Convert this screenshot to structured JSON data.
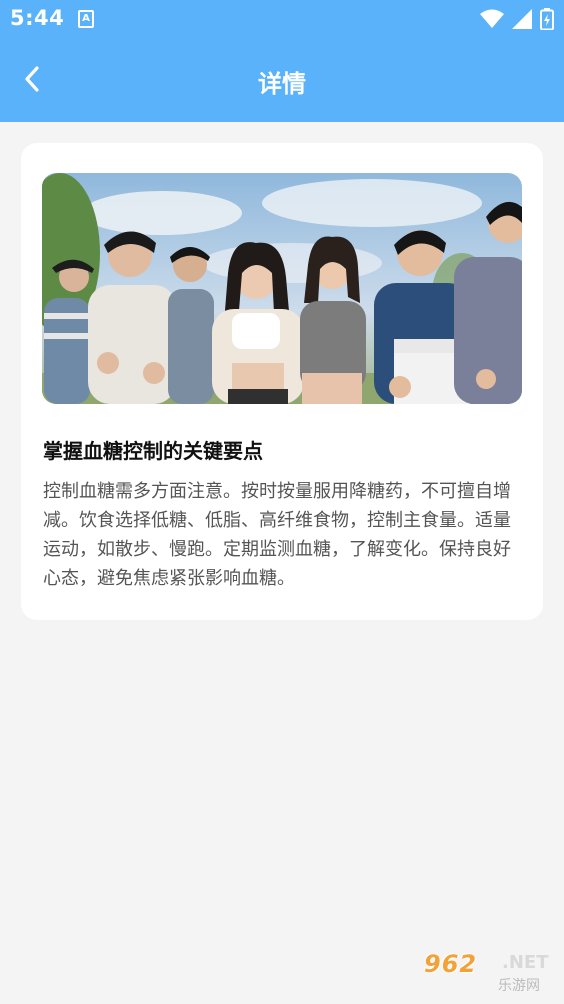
{
  "status_bar": {
    "time": "5:44",
    "notification_badge": "A",
    "icons": [
      "wifi-icon",
      "signal-icon",
      "battery-icon"
    ]
  },
  "header": {
    "title": "详情",
    "back_icon": "chevron-left-icon"
  },
  "article": {
    "image_description": "group of young people running outdoors",
    "title": "掌握血糖控制的关键要点",
    "body": "控制血糖需多方面注意。按时按量服用降糖药，不可擅自增减。饮食选择低糖、低脂、高纤维食物，控制主食量。适量运动，如散步、慢跑。定期监测血糖，了解变化。保持良好心态，避免焦虑紧张影响血糖。"
  },
  "watermark": {
    "brand": "962",
    "domain": ".NET",
    "name": "乐游网"
  },
  "colors": {
    "header_bg": "#5ab2fa",
    "page_bg": "#f4f4f4",
    "card_bg": "#ffffff",
    "title_text": "#111111",
    "body_text": "#555555"
  }
}
